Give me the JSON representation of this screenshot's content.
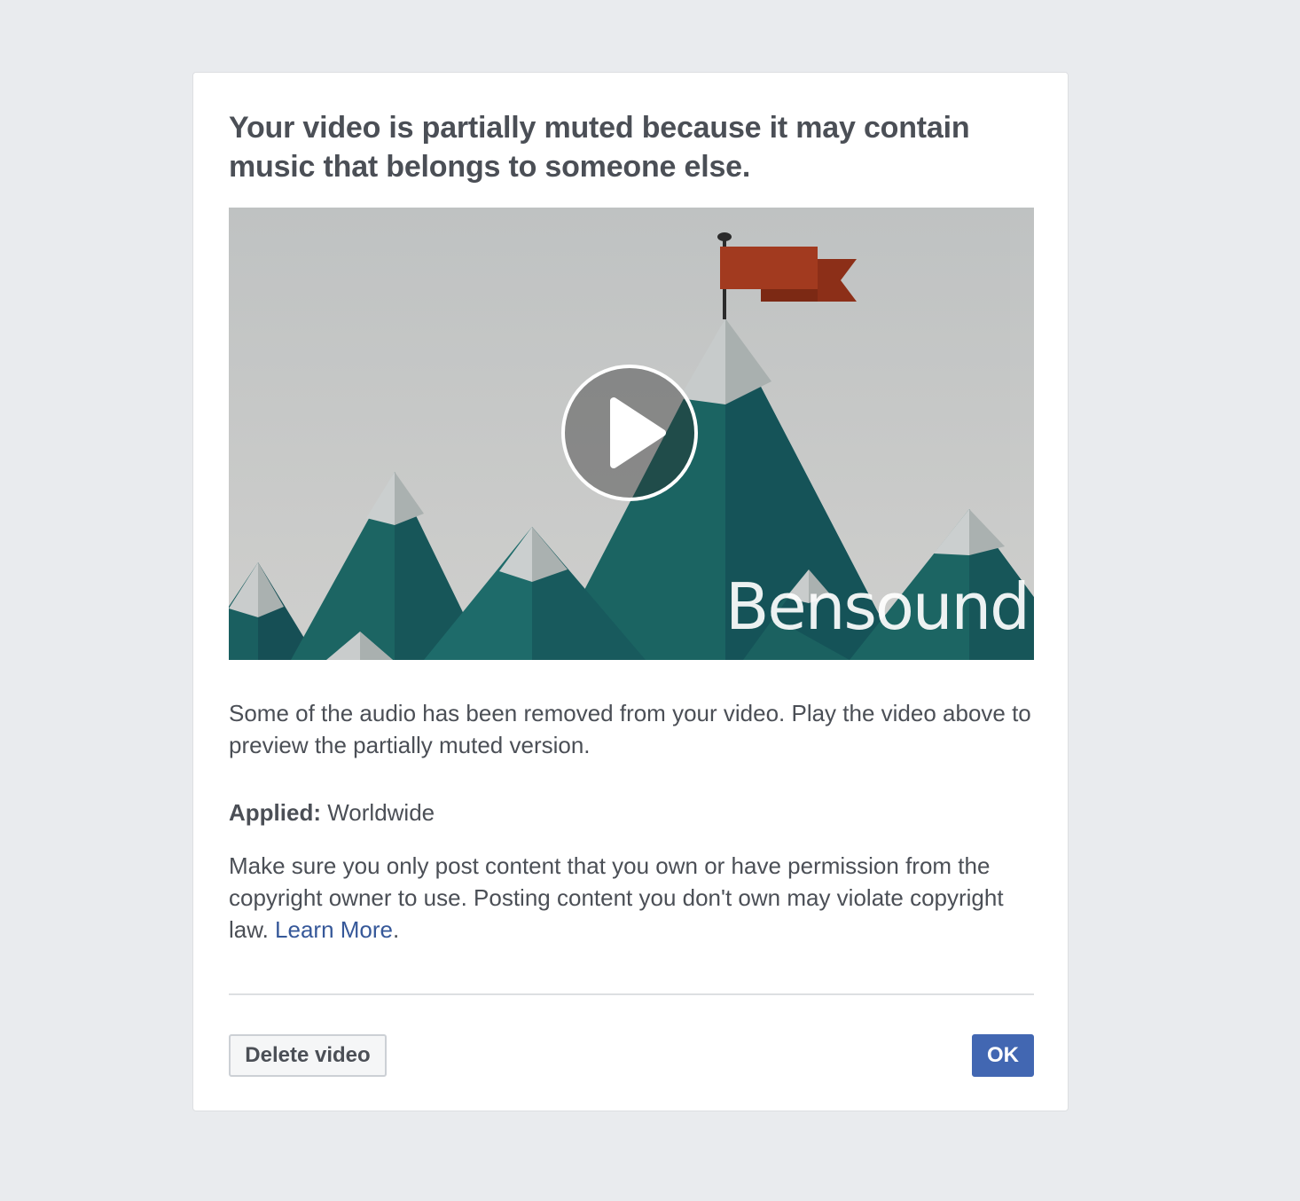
{
  "dialog": {
    "title": "Your video is partially muted because it may contain music that belongs to someone else.",
    "video": {
      "watermark": "Bensound",
      "play_icon": "play-icon"
    },
    "description": "Some of the audio has been removed from your video. Play the video above to preview the partially muted version.",
    "applied": {
      "label": "Applied:",
      "value": "Worldwide"
    },
    "copyright": {
      "text": "Make sure you only post content that you own or have permission from the copyright owner to use. Posting content you don't own may violate copyright law.",
      "link_label": "Learn More",
      "trailing": "."
    },
    "buttons": {
      "delete_label": "Delete video",
      "ok_label": "OK"
    }
  },
  "colors": {
    "background": "#e9ebee",
    "primary": "#4267b2",
    "link": "#365899",
    "text": "#4b4f56",
    "flag": "#a23a1f",
    "mountain": "#1b6462"
  }
}
